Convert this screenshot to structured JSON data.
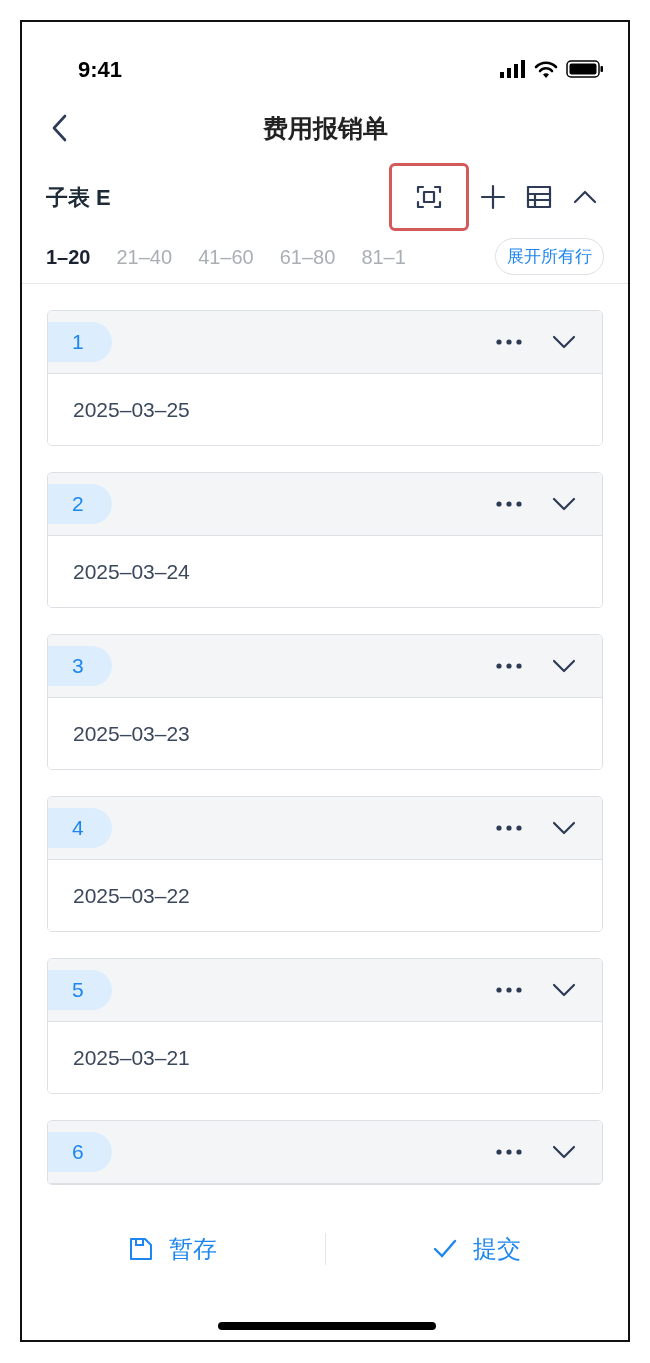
{
  "status_bar": {
    "time": "9:41"
  },
  "nav": {
    "title": "费用报销单"
  },
  "subtable": {
    "title": "子表 E",
    "tools": [
      {
        "kind": "scan",
        "highlighted": true
      },
      {
        "kind": "add",
        "highlighted": false
      },
      {
        "kind": "table",
        "highlighted": false
      },
      {
        "kind": "collapse",
        "highlighted": false
      }
    ],
    "pages": [
      {
        "label": "1–20",
        "selected": true
      },
      {
        "label": "21–40",
        "selected": false
      },
      {
        "label": "41–60",
        "selected": false
      },
      {
        "label": "61–80",
        "selected": false
      },
      {
        "label": "81–1",
        "selected": false
      }
    ],
    "expand_all": "展开所有行"
  },
  "rows": [
    {
      "index": "1",
      "value": "2025–03–25"
    },
    {
      "index": "2",
      "value": "2025–03–24"
    },
    {
      "index": "3",
      "value": "2025–03–23"
    },
    {
      "index": "4",
      "value": "2025–03–22"
    },
    {
      "index": "5",
      "value": "2025–03–21"
    },
    {
      "index": "6"
    }
  ],
  "actions": [
    {
      "kind": "save",
      "label": "暂存"
    },
    {
      "kind": "submit",
      "label": "提交"
    }
  ]
}
